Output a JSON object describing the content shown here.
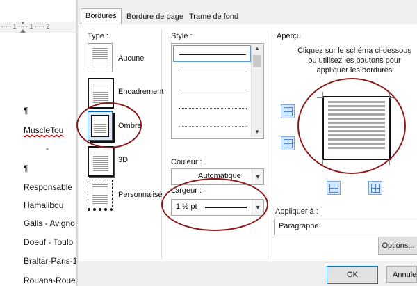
{
  "document": {
    "ruler_text": "· · · 1 · · · 1 · · · 2",
    "lines": [
      "¶",
      "MuscleTou",
      "-",
      "¶",
      "Responsable",
      "Hamalibou",
      "Galls - Avigno",
      "Doeuf - Toulo",
      "Braltar-Paris-1",
      "Rouana-Rouen"
    ]
  },
  "dialog": {
    "tabs": [
      {
        "label": "Bordures",
        "active": true
      },
      {
        "label": "Bordure de page",
        "active": false
      },
      {
        "label": "Trame de fond",
        "active": false
      }
    ],
    "type": {
      "heading": "Type :",
      "presets": [
        {
          "label": "Aucune"
        },
        {
          "label": "Encadrement"
        },
        {
          "label": "Ombre",
          "selected": true
        },
        {
          "label": "3D"
        },
        {
          "label": "Personnalisé"
        }
      ]
    },
    "style": {
      "heading": "Style :",
      "items": [
        "solid",
        "solid-thin",
        "solid-gray",
        "dotted",
        "dotted-fine"
      ]
    },
    "couleur": {
      "label": "Couleur :",
      "value": "Automatique"
    },
    "largeur": {
      "label": "Largeur :",
      "value": "1 ½ pt"
    },
    "apercu": {
      "heading": "Aperçu",
      "instructions": "Cliquez sur le schéma ci-dessous ou utilisez les boutons pour appliquer les bordures"
    },
    "appliquer": {
      "label": "Appliquer à :",
      "value": "Paragraphe"
    },
    "buttons": {
      "options": "Options...",
      "ok": "OK",
      "annuler": "Annuler"
    },
    "colors": {
      "annotation": "#8b1a1a",
      "accent": "#0078d7"
    }
  }
}
